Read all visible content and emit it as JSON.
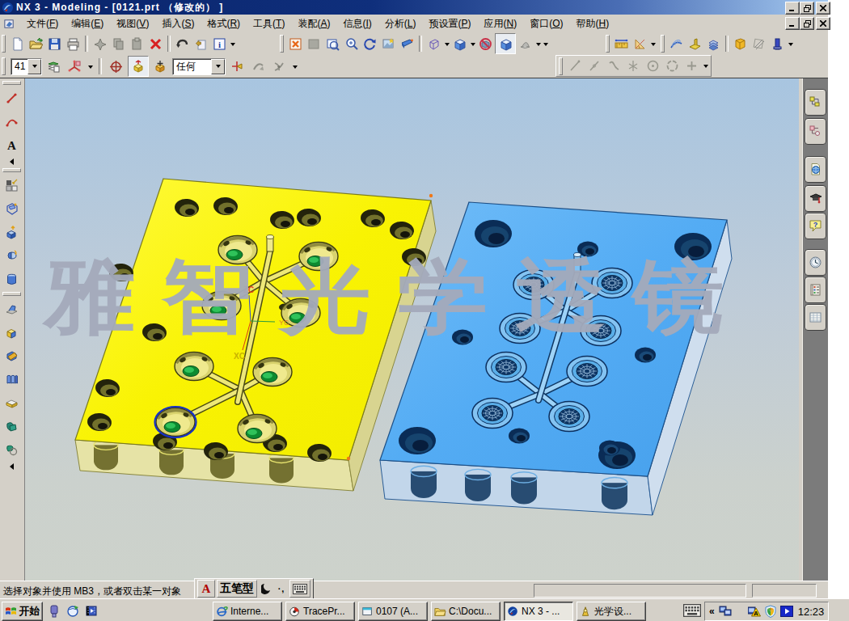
{
  "window": {
    "title": "NX 3 - Modeling - [0121.prt （修改的） ]",
    "controls": [
      "minimize",
      "restore",
      "close"
    ]
  },
  "menu": {
    "items": [
      {
        "label": "文件",
        "mnemonic": "F"
      },
      {
        "label": "编辑",
        "mnemonic": "E"
      },
      {
        "label": "视图",
        "mnemonic": "V"
      },
      {
        "label": "插入",
        "mnemonic": "S"
      },
      {
        "label": "格式",
        "mnemonic": "R"
      },
      {
        "label": "工具",
        "mnemonic": "T"
      },
      {
        "label": "装配",
        "mnemonic": "A"
      },
      {
        "label": "信息",
        "mnemonic": "I"
      },
      {
        "label": "分析",
        "mnemonic": "L"
      },
      {
        "label": "预设置",
        "mnemonic": "P"
      },
      {
        "label": "应用",
        "mnemonic": "N"
      },
      {
        "label": "窗口",
        "mnemonic": "O"
      },
      {
        "label": "帮助",
        "mnemonic": "H"
      }
    ]
  },
  "toolbars": {
    "standard": {
      "icons": [
        "new-file",
        "open-folder",
        "save",
        "print",
        "cut",
        "copy",
        "paste",
        "delete",
        "undo",
        "update",
        "information"
      ]
    },
    "view": {
      "icons": [
        "fit-view",
        "disabled-view",
        "zoom-box",
        "zoom",
        "rotate",
        "snapshot",
        "perspective",
        "wireframe-cube",
        "shaded-cube",
        "no-show",
        "shaded-pressed",
        "sheet-cone"
      ]
    },
    "measure": {
      "icons": [
        "measure-distance",
        "measure-angle"
      ]
    },
    "analysis": {
      "icons": [
        "curve-analysis",
        "face-analysis",
        "section-analysis",
        "examine-geometry",
        "deviation",
        "simple-interference"
      ]
    },
    "utility": {
      "work_layer_value": "41",
      "selection_filter_value": "任何",
      "icons": [
        "layer-settings",
        "wcs-display",
        "orient-wcs",
        "wcs-dynamics",
        "wcs-origin",
        "snap-point",
        "end-point",
        "intersection-point"
      ]
    },
    "sketch": {
      "icons": [
        "profile-line",
        "sketch-line",
        "sketch-spline",
        "sketch-axis",
        "circle-center",
        "sketch-circle",
        "sketch-point"
      ]
    }
  },
  "left_toolbar": {
    "curve_icons": [
      "basic-curve",
      "arc",
      "text"
    ],
    "feature_icons": [
      "sketch",
      "datum-plane",
      "extrude",
      "revolve",
      "cylinder"
    ],
    "operation_icons": [
      "draft",
      "block",
      "trim-body",
      "mold-wizard",
      "pad",
      "unite",
      "subtract"
    ]
  },
  "resource_bar": {
    "tabs": [
      "assembly-navigator",
      "part-navigator",
      "web-browser",
      "training",
      "help",
      "history",
      "palettes",
      "spreadsheet"
    ]
  },
  "viewport": {
    "watermark": "雅智光学透镜",
    "wcs_labels": {
      "z": "ZC",
      "x": "XC",
      "y": "YC"
    },
    "plates": [
      "yellow-mold-plate",
      "blue-mold-plate"
    ]
  },
  "status_bar": {
    "message": "选择对象并使用 MB3，或者双击某一对象"
  },
  "ime_bar": {
    "letter": "A",
    "mode": "五笔型",
    "moon_icon": "crescent-moon",
    "punct": "·,"
  },
  "taskbar": {
    "start_label": "开始",
    "quick_launch": [
      "device",
      "launch-browser",
      "media-player"
    ],
    "buttons": [
      {
        "label": "Interne...",
        "icon": "ie"
      },
      {
        "label": "TracePr...",
        "icon": "tracepro"
      },
      {
        "label": "0107 (A...",
        "icon": "window-app"
      },
      {
        "label": "C:\\Docu...",
        "icon": "folder-win"
      },
      {
        "label": "NX 3 - ...",
        "icon": "nx-logo",
        "active": true
      },
      {
        "label": "光学设...",
        "icon": "optics-app"
      }
    ],
    "tray_icons": [
      "collapse-chevrons",
      "network-monitors",
      "warning-monitor",
      "shield",
      "media-play"
    ],
    "clock": "12:23"
  },
  "colors": {
    "titlebar_left": "#0a246a",
    "titlebar_right": "#a6caf0",
    "window_face": "#d4d0c8",
    "viewport_top": "#afc9e2",
    "viewport_bottom": "#cdd2cb",
    "yellow_plate": "#f6f106",
    "yellow_side": "#e9e6a0",
    "blue_plate": "#55acf2",
    "blue_side": "#a8cdee",
    "lens_green": "#17a33c",
    "watermark_gray": "#9ca3b4",
    "resource_bar": "#7b7b7b"
  }
}
